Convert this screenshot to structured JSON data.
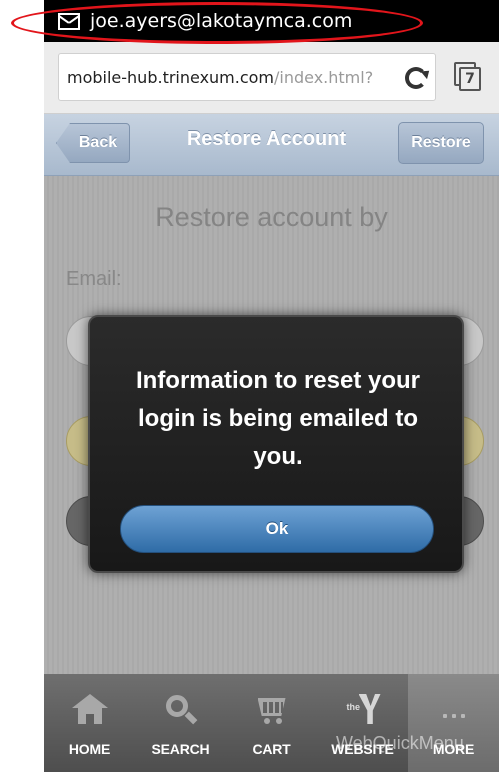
{
  "status_bar": {
    "account_email": "joe.ayers@lakotaymca.com",
    "icon": "gmail-icon"
  },
  "browser": {
    "url_host": "mobile-hub.trinexum.com",
    "url_path": "/index.html?",
    "tab_count": "7"
  },
  "app_header": {
    "back_label": "Back",
    "title": "Restore Account",
    "restore_label": "Restore"
  },
  "content": {
    "heading": "Restore account by",
    "email_label": "Email:"
  },
  "dialog": {
    "message": "Information to reset your login is being emailed to you.",
    "ok_label": "Ok"
  },
  "tabbar": {
    "items": [
      {
        "label": "HOME",
        "icon": "home-icon"
      },
      {
        "label": "SEARCH",
        "icon": "search-icon"
      },
      {
        "label": "CART",
        "icon": "cart-icon"
      },
      {
        "label": "WEBSITE",
        "icon": "ymca-logo-icon",
        "logo_text": "the"
      },
      {
        "label": "MORE",
        "icon": "more-dots-icon"
      }
    ]
  },
  "watermark": "WebQuickMenu",
  "colors": {
    "annotation_oval": "#e2151b",
    "header": "#b8c6d8",
    "ok_button": "#3f7dbb"
  }
}
